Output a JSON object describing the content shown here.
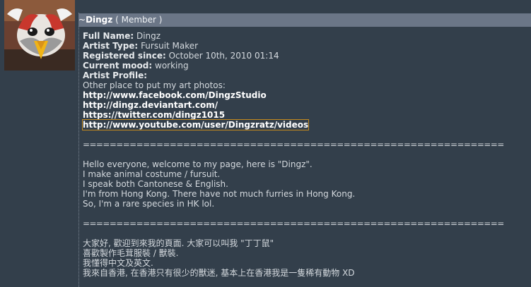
{
  "user": {
    "prefix": "~",
    "name": "Dingz",
    "role": "( Member )"
  },
  "profile": {
    "full_name_label": "Full Name:",
    "full_name": "Dingz",
    "artist_type_label": "Artist Type:",
    "artist_type": "Fursuit Maker",
    "registered_label": "Registered since:",
    "registered": "October 10th, 2010 01:14",
    "mood_label": "Current mood:",
    "mood": "working",
    "artist_profile_label": "Artist Profile:"
  },
  "bio": {
    "links_intro": "Other place to put my art photos:",
    "links": [
      "http://www.facebook.com/DingzStudio",
      "http://dingz.deviantart.com/",
      "https://twitter.com/dingz1015",
      "http://www.youtube.com/user/Dingzratz/videos"
    ],
    "separator": "===============================================================",
    "english": [
      "Hello everyone, welcome to my page, here is \"Dingz\".",
      "I make animal costume / fursuit.",
      "I speak both Cantonese & English.",
      "I'm from Hong Kong. There have not much furries in Hong Kong.",
      "So, I'm a rare species in HK lol."
    ],
    "chinese": [
      "大家好, 歡迎到來我的頁面. 大家可以叫我 \"丁丁鼠\"",
      "喜歡製作毛茸服裝 / 獸裝.",
      "我懂得中文及英文.",
      "我來自香港, 在香港只有很少的獸迷, 基本上在香港我是一隻稀有動物 XD"
    ]
  },
  "colors": {
    "background": "#333f4b",
    "name_bar": "#6b7687",
    "focus_outline": "#c58a1e"
  }
}
